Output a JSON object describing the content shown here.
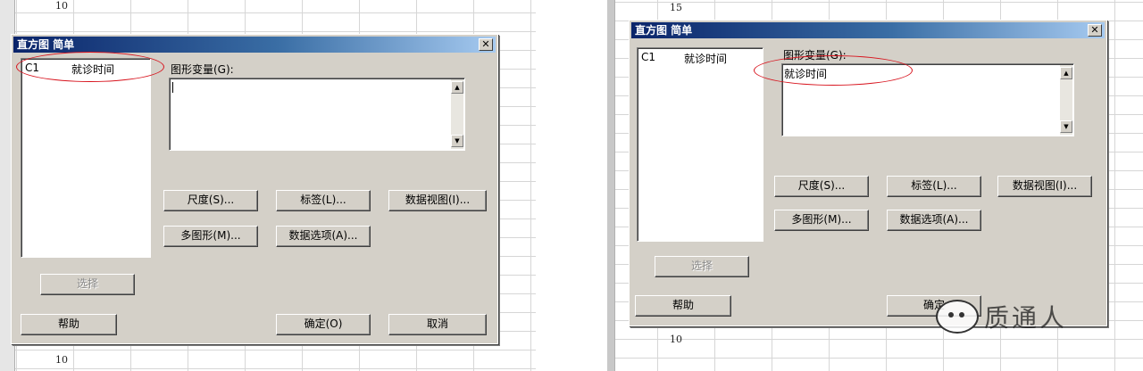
{
  "left": {
    "row_numbers": [
      "10",
      "10"
    ],
    "dialog": {
      "title": "直方图 简单",
      "close_glyph": "✕",
      "variable_list": {
        "column_id": "C1",
        "column_name": "就诊时间"
      },
      "graph_variables_label": "图形变量(G):",
      "buttons": {
        "scale": "尺度(S)...",
        "labels": "标签(L)...",
        "data_view": "数据视图(I)...",
        "multiple_graphs": "多图形(M)...",
        "data_options": "数据选项(A)...",
        "select": "选择",
        "help": "帮助",
        "ok": "确定(O)",
        "cancel": "取消"
      }
    }
  },
  "right": {
    "row_numbers": [
      "15",
      "10"
    ],
    "dialog": {
      "title": "直方图 简单",
      "close_glyph": "✕",
      "variable_list": {
        "column_id": "C1",
        "column_name": "就诊时间"
      },
      "graph_variables_label": "图形变量(G):",
      "graph_variables_value": "就诊时间",
      "buttons": {
        "scale": "尺度(S)...",
        "labels": "标签(L)...",
        "data_view": "数据视图(I)...",
        "multiple_graphs": "多图形(M)...",
        "data_options": "数据选项(A)...",
        "select": "选择",
        "help": "帮助",
        "ok": "确定"
      }
    }
  },
  "watermark": {
    "text": "质通人"
  },
  "colors": {
    "dialog_face": "#d4d0c8",
    "title_gradient_start": "#0a246a",
    "title_gradient_end": "#a6caf0",
    "annotation_oval": "#d8141e"
  },
  "icons": {
    "close": "close-icon",
    "scroll_up": "scroll-up-arrow-icon",
    "scroll_down": "scroll-down-arrow-icon",
    "watermark": "chat-bubble-icon"
  }
}
